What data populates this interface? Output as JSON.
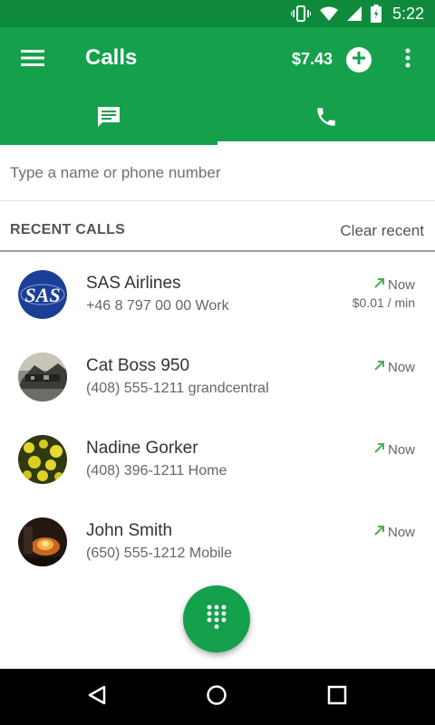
{
  "status_bar": {
    "time": "5:22",
    "icons": [
      "vibrate-icon",
      "wifi-icon",
      "signal-icon",
      "battery-icon"
    ]
  },
  "app_bar": {
    "title": "Calls",
    "credit": "$7.43",
    "color": "#15a04c",
    "status_color": "#0f8a3d",
    "tabs": [
      {
        "name": "messages-tab",
        "icon": "message-icon",
        "active": false
      },
      {
        "name": "calls-tab",
        "icon": "phone-icon",
        "active": true
      }
    ]
  },
  "search": {
    "placeholder": "Type a name or phone number",
    "value": ""
  },
  "recent": {
    "title": "RECENT CALLS",
    "clear_label": "Clear recent"
  },
  "calls": [
    {
      "name": "SAS Airlines",
      "detail": "+46 8 797 00 00 Work",
      "time": "Now",
      "rate": "$0.01 / min",
      "avatar": "sas-logo",
      "avatar_text": "SAS"
    },
    {
      "name": "Cat Boss 950",
      "detail": "(408) 555-1211 grandcentral",
      "time": "Now",
      "rate": "",
      "avatar": "photo-dark"
    },
    {
      "name": "Nadine Gorker",
      "detail": "(408) 396-1211 Home",
      "time": "Now",
      "rate": "",
      "avatar": "photo-flowers"
    },
    {
      "name": "John Smith",
      "detail": "(650) 555-1212 Mobile",
      "time": "Now",
      "rate": "",
      "avatar": "photo-fire"
    }
  ],
  "fab": {
    "icon": "dialpad-icon"
  },
  "nav": {
    "icons": [
      "back-icon",
      "home-icon",
      "recents-icon"
    ]
  }
}
